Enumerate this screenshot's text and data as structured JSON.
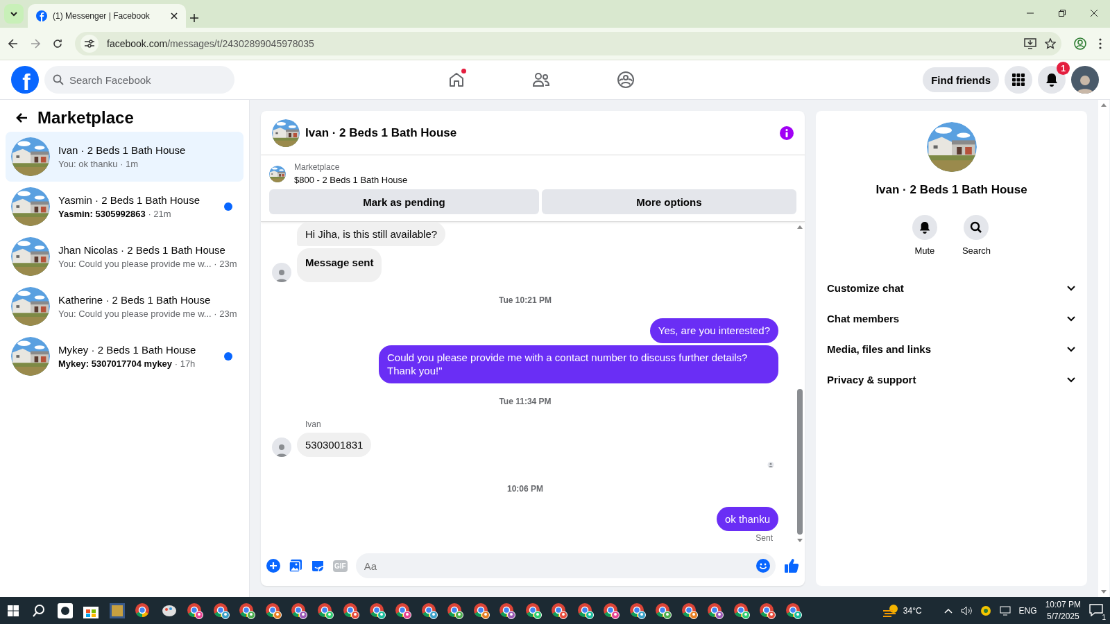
{
  "browser": {
    "tab_title": "(1) Messenger | Facebook",
    "url_host": "facebook.com",
    "url_path": "/messages/t/24302899045978035"
  },
  "header": {
    "logo": "f",
    "search_placeholder": "Search Facebook",
    "find_friends": "Find friends",
    "notification_count": "1"
  },
  "sidebar": {
    "title": "Marketplace",
    "conversations": [
      {
        "name": "Ivan · 2 Beds 1 Bath House",
        "preview": "You: ok thanku",
        "time": "· 1m",
        "selected": true,
        "unread": false
      },
      {
        "name": "Yasmin · 2 Beds 1 Bath House",
        "preview": "Yasmin: 5305992863",
        "time": "· 21m",
        "selected": false,
        "unread": true
      },
      {
        "name": "Jhan Nicolas · 2 Beds 1 Bath House",
        "preview": "You: Could you please provide me w...",
        "time": "· 23m",
        "selected": false,
        "unread": false
      },
      {
        "name": "Katherine · 2 Beds 1 Bath House",
        "preview": "You: Could you please provide me w...",
        "time": "· 23m",
        "selected": false,
        "unread": false
      },
      {
        "name": "Mykey · 2 Beds 1 Bath House",
        "preview": "Mykey: 5307017704 mykey",
        "time": "· 17h",
        "selected": false,
        "unread": true
      }
    ]
  },
  "chat": {
    "title": "Ivan · 2 Beds 1 Bath House",
    "listing": {
      "source": "Marketplace",
      "title": "$800 - 2 Beds 1 Bath House",
      "buttons": [
        "Mark as pending",
        "More options"
      ]
    },
    "messages": [
      {
        "kind": "incoming",
        "text": "Hi Jiha, is this still available?",
        "bold": false,
        "avatar": false
      },
      {
        "kind": "incoming",
        "text": "Message sent",
        "bold": true,
        "avatar": true
      },
      {
        "kind": "time",
        "text": "Tue 10:21 PM"
      },
      {
        "kind": "outgoing",
        "text": "Yes, are you interested?"
      },
      {
        "kind": "outgoing",
        "text": "Could you please provide me with a contact number to discuss further details? Thank you!\""
      },
      {
        "kind": "time",
        "text": "Tue 11:34 PM"
      },
      {
        "kind": "sender",
        "text": "Ivan"
      },
      {
        "kind": "incoming",
        "text": "5303001831",
        "bold": false,
        "avatar": true
      },
      {
        "kind": "seen"
      },
      {
        "kind": "time",
        "text": "10:06 PM"
      },
      {
        "kind": "outgoing",
        "text": "ok thanku"
      },
      {
        "kind": "status",
        "text": "Sent"
      }
    ],
    "composer": {
      "gif": "GIF",
      "placeholder": "Aa"
    }
  },
  "details": {
    "name": "Ivan · 2 Beds 1 Bath House",
    "actions": [
      "Mute",
      "Search"
    ],
    "sections": [
      {
        "label": "Customize chat",
        "expanded": false
      },
      {
        "label": "Chat members",
        "expanded": false
      },
      {
        "label": "Media, files and links",
        "expanded": false
      },
      {
        "label": "Privacy & support",
        "expanded": false
      }
    ]
  },
  "taskbar": {
    "weather": "34°C",
    "language": "ENG",
    "time": "10:07 PM",
    "date": "5/7/2025",
    "notifications": "1"
  }
}
